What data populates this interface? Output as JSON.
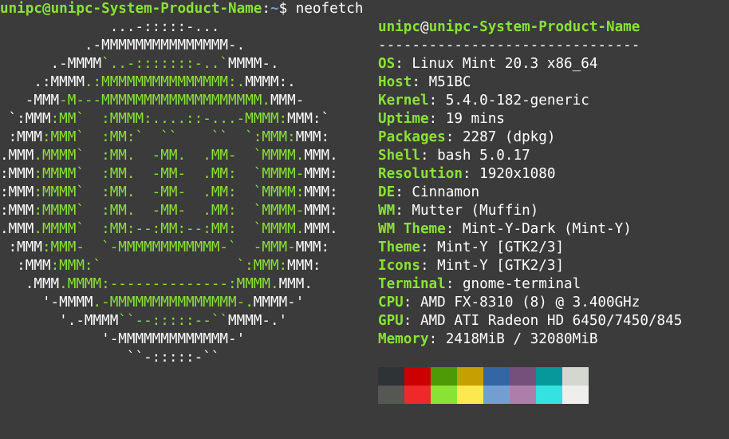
{
  "prompt": {
    "user": "unipc",
    "at": "@",
    "host": "unipc-System-Product-Name",
    "sep": ":",
    "path": "~",
    "symbol": "$",
    "command": "neofetch"
  },
  "info": {
    "user": "unipc",
    "at": "@",
    "host": "unipc-System-Product-Name",
    "divider": "-------------------------------",
    "fields": [
      {
        "label": "OS",
        "value": "Linux Mint 20.3 x86_64"
      },
      {
        "label": "Host",
        "value": "M51BC"
      },
      {
        "label": "Kernel",
        "value": "5.4.0-182-generic"
      },
      {
        "label": "Uptime",
        "value": "19 mins"
      },
      {
        "label": "Packages",
        "value": "2287 (dpkg)"
      },
      {
        "label": "Shell",
        "value": "bash 5.0.17"
      },
      {
        "label": "Resolution",
        "value": "1920x1080"
      },
      {
        "label": "DE",
        "value": "Cinnamon"
      },
      {
        "label": "WM",
        "value": "Mutter (Muffin)"
      },
      {
        "label": "WM Theme",
        "value": "Mint-Y-Dark (Mint-Y)"
      },
      {
        "label": "Theme",
        "value": "Mint-Y [GTK2/3]"
      },
      {
        "label": "Icons",
        "value": "Mint-Y [GTK2/3]"
      },
      {
        "label": "Terminal",
        "value": "gnome-terminal"
      },
      {
        "label": "CPU",
        "value": "AMD FX-8310 (8) @ 3.400GHz"
      },
      {
        "label": "GPU",
        "value": "AMD ATI Radeon HD 6450/7450/845"
      },
      {
        "label": "Memory",
        "value": "2418MiB / 32080MiB"
      }
    ],
    "colon": ": "
  },
  "logo": [
    [
      [
        "w",
        "             ...-:::::-..."
      ]
    ],
    [
      [
        "w",
        "          .-MMMMMMMMMMMMMMM-."
      ]
    ],
    [
      [
        "w",
        "      .-MMMM"
      ],
      [
        "g",
        "`..-:::::::-..`"
      ],
      [
        "w",
        "MMMM-."
      ]
    ],
    [
      [
        "w",
        "    .:MMMM"
      ],
      [
        "g",
        ".:MMMMMMMMMMMMMMM:."
      ],
      [
        "w",
        "MMMM:."
      ]
    ],
    [
      [
        "w",
        "   -MMM"
      ],
      [
        "g",
        "-M---MMMMMMMMMMMMMMMMMMM."
      ],
      [
        "w",
        "MMM-"
      ]
    ],
    [
      [
        "w",
        " `:MMM"
      ],
      [
        "g",
        ":MM`  :MMMM:....::-...-MMMM:"
      ],
      [
        "w",
        "MMM:`"
      ]
    ],
    [
      [
        "w",
        " :MMM"
      ],
      [
        "g",
        ":MMM`  :MM:`  ``    ``  `:MMM:"
      ],
      [
        "w",
        "MMM:"
      ]
    ],
    [
      [
        "w",
        ".MMM"
      ],
      [
        "g",
        ".MMMM`  :MM.  -MM.  .MM-  `MMMM."
      ],
      [
        "w",
        "MMM."
      ]
    ],
    [
      [
        "w",
        ":MMM"
      ],
      [
        "g",
        ":MMMM`  :MM.  -MM-  .MM:  `MMMM-"
      ],
      [
        "w",
        "MMM:"
      ]
    ],
    [
      [
        "w",
        ":MMM"
      ],
      [
        "g",
        ":MMMM`  :MM.  -MM-  .MM:  `MMMM:"
      ],
      [
        "w",
        "MMM:"
      ]
    ],
    [
      [
        "w",
        ":MMM"
      ],
      [
        "g",
        ":MMMM`  :MM.  -MM-  .MM:  `MMMM-"
      ],
      [
        "w",
        "MMM:"
      ]
    ],
    [
      [
        "w",
        ".MMM"
      ],
      [
        "g",
        ".MMMM`  :MM:--:MM:--:MM:  `MMMM."
      ],
      [
        "w",
        "MMM."
      ]
    ],
    [
      [
        "w",
        " :MMM"
      ],
      [
        "g",
        ":MMM-  `-MMMMMMMMMMMM-`  -MMM-"
      ],
      [
        "w",
        "MMM:"
      ]
    ],
    [
      [
        "w",
        "  :MMM"
      ],
      [
        "g",
        ":MMM:`                `:MMM:"
      ],
      [
        "w",
        "MMM:"
      ]
    ],
    [
      [
        "w",
        "   .MMM"
      ],
      [
        "g",
        ".MMMM:--------------:MMMM."
      ],
      [
        "w",
        "MMM."
      ]
    ],
    [
      [
        "w",
        "     '-MMMM"
      ],
      [
        "g",
        ".-MMMMMMMMMMMMMMM-."
      ],
      [
        "w",
        "MMMM-'"
      ]
    ],
    [
      [
        "w",
        "       '.-MMMM"
      ],
      [
        "g",
        "``--:::::--``"
      ],
      [
        "w",
        "MMMM-.'"
      ]
    ],
    [
      [
        "w",
        "            '-MMMMMMMMMMMMM-'"
      ]
    ],
    [
      [
        "w",
        "               ``-:::::-``"
      ]
    ]
  ],
  "palette": {
    "normal": [
      "#2e3436",
      "#cc0000",
      "#4e9a06",
      "#c4a000",
      "#3465a4",
      "#75507b",
      "#06989a",
      "#d3d7cf"
    ],
    "bright": [
      "#555753",
      "#ef2929",
      "#8ae234",
      "#fce94f",
      "#729fcf",
      "#ad7fa8",
      "#34e2e2",
      "#eeeeec"
    ]
  },
  "colors": {
    "background": "#3b3b3b",
    "green": "#8ae234",
    "path": "#729fcf",
    "text": "#ffffff"
  }
}
